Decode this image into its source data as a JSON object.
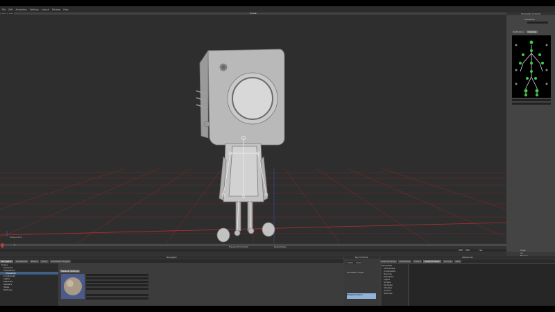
{
  "menu": [
    "File",
    "Edit",
    "Animation",
    "Settings",
    "Layout",
    "Window",
    "Help"
  ],
  "viewport": {
    "title": "Scene",
    "camera_label": "Perspective",
    "grid_color": "#8a2a2a",
    "bg_color": "#2e2e2e"
  },
  "character_controls": {
    "title": "Character Controls",
    "tabs": [
      "Definition",
      "Controls"
    ],
    "character_label": "Character"
  },
  "transport": {
    "frame_label": "0",
    "center_text": "Transport Controls",
    "range_label": "Global Keys",
    "fps_label": "FPS",
    "end_label": "Snap on Frames"
  },
  "navigator": {
    "title": "Navigator",
    "tabs": [
      "Navigator",
      "Dopesheet",
      "Filters",
      "Story",
      "Animation Trigger"
    ],
    "material_tab": "Material Settings",
    "tree": [
      "Scene",
      "Cameras",
      "Characters",
      "Character",
      "Constraints",
      "Lights",
      "Materials",
      "Shaders",
      "Takes",
      "Textures"
    ]
  },
  "key_controls": {
    "title": "Key Controls",
    "animation_layer_label": "Animation Layer",
    "base_layer": "BaseAnimation"
  },
  "resources": {
    "title": "Resources",
    "tabs": [
      "Pose Controls",
      "Properties",
      "Filters",
      "Asset Browser",
      "Groups",
      "Sets"
    ],
    "tree": [
      "Templates",
      "Characters",
      "Constraints",
      "Devices",
      "Elements",
      "Lights",
      "Scripts",
      "Samples",
      "Shaders",
      "Solvers",
      "Tutorials"
    ]
  }
}
